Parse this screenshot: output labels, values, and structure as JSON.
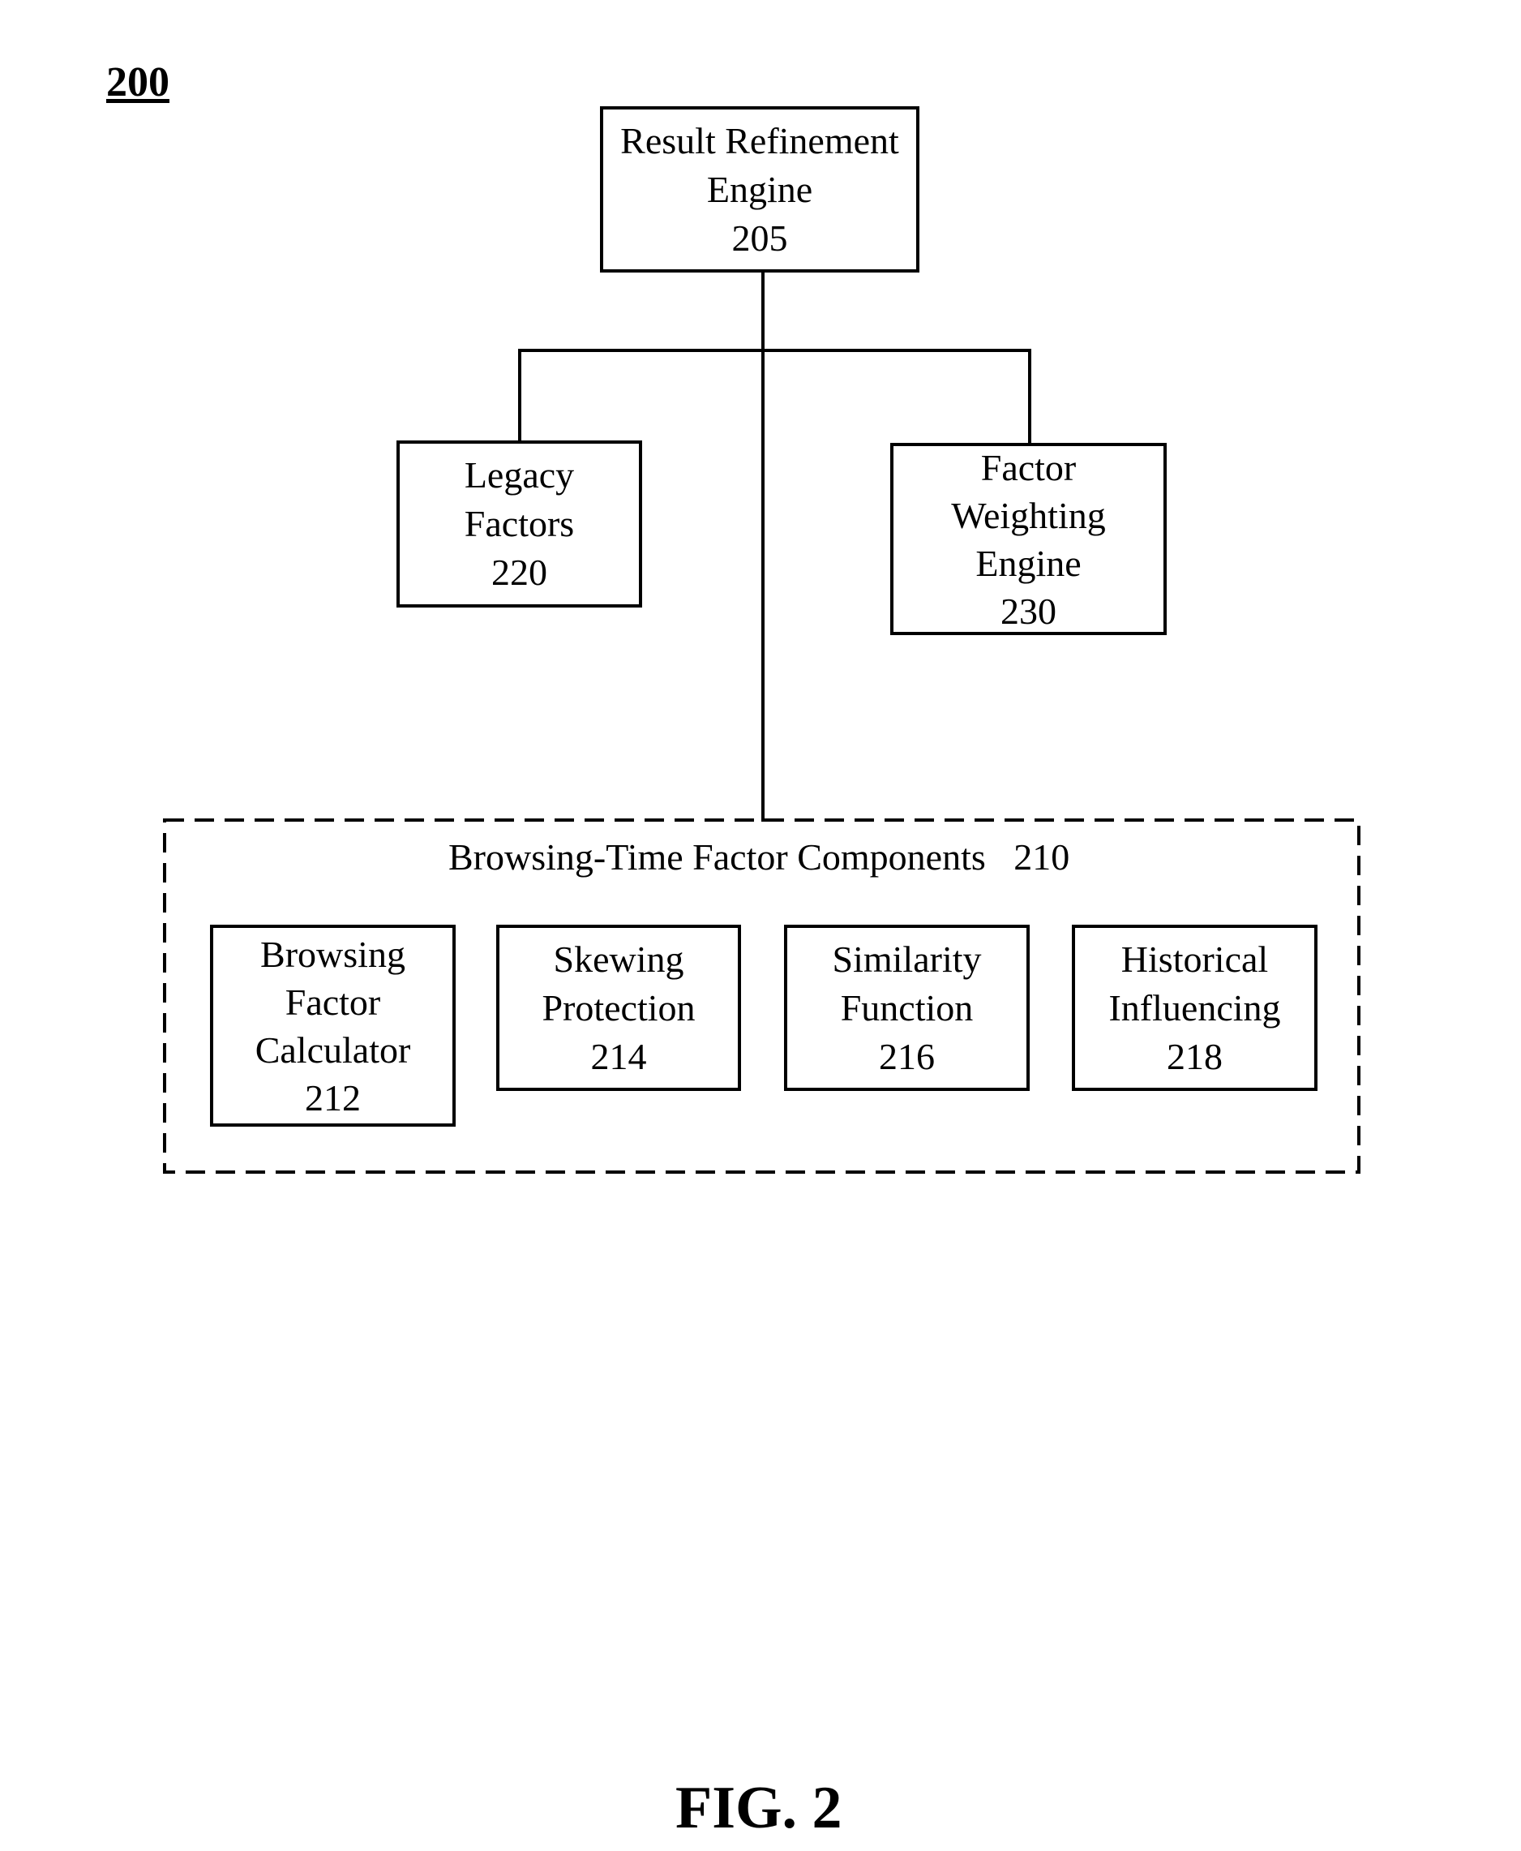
{
  "figure": {
    "reference_label": "200",
    "caption": "FIG. 2"
  },
  "nodes": {
    "result_refinement_engine": {
      "lines": [
        "Result Refinement",
        "Engine",
        "205"
      ]
    },
    "legacy_factors": {
      "lines": [
        "Legacy",
        "Factors",
        "220"
      ]
    },
    "factor_weighting_engine": {
      "lines": [
        "Factor",
        "Weighting",
        "Engine",
        "230"
      ]
    }
  },
  "group": {
    "title": "Browsing-Time Factor Components",
    "number": "210",
    "components": [
      {
        "lines": [
          "Browsing",
          "Factor",
          "Calculator",
          "212"
        ]
      },
      {
        "lines": [
          "Skewing",
          "Protection",
          "214"
        ]
      },
      {
        "lines": [
          "Similarity",
          "Function",
          "216"
        ]
      },
      {
        "lines": [
          "Historical",
          "Influencing",
          "218"
        ]
      }
    ]
  },
  "connections": [
    {
      "from": "205",
      "to": "220"
    },
    {
      "from": "205",
      "to": "230"
    },
    {
      "from": "205",
      "to": "210"
    }
  ]
}
